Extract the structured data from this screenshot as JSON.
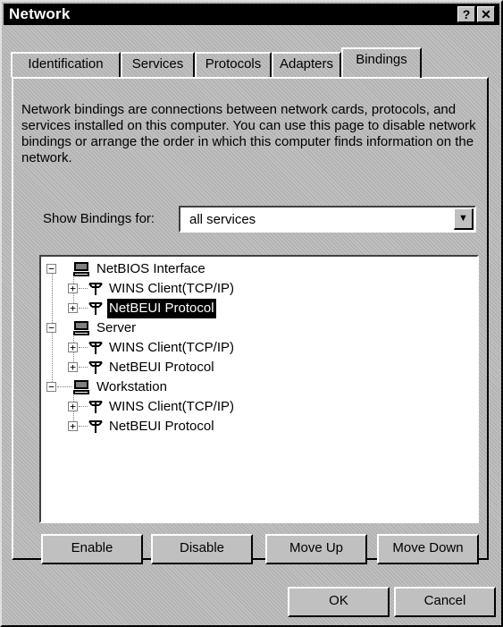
{
  "window": {
    "title": "Network"
  },
  "titlebar": {
    "help_label": "?",
    "close_label": "✕"
  },
  "tabs": [
    {
      "label": "Identification"
    },
    {
      "label": "Services"
    },
    {
      "label": "Protocols"
    },
    {
      "label": "Adapters"
    },
    {
      "label": "Bindings"
    }
  ],
  "active_tab": "Bindings",
  "description": "Network bindings are connections between network cards, protocols, and services installed on this computer. You can use this page to disable network bindings or arrange the order in which this computer finds information on the network.",
  "show_bindings": {
    "label": "Show Bindings for:",
    "value": "all services"
  },
  "tree": [
    {
      "label": "NetBIOS Interface",
      "icon": "computer-icon",
      "expanded": true,
      "children": [
        {
          "label": "WINS Client(TCP/IP)",
          "icon": "protocol-icon"
        },
        {
          "label": "NetBEUI Protocol",
          "icon": "protocol-icon",
          "selected": true
        }
      ]
    },
    {
      "label": "Server",
      "icon": "computer-icon",
      "expanded": true,
      "children": [
        {
          "label": "WINS Client(TCP/IP)",
          "icon": "protocol-icon"
        },
        {
          "label": "NetBEUI Protocol",
          "icon": "protocol-icon"
        }
      ]
    },
    {
      "label": "Workstation",
      "icon": "computer-icon",
      "expanded": true,
      "children": [
        {
          "label": "WINS Client(TCP/IP)",
          "icon": "protocol-icon"
        },
        {
          "label": "NetBEUI Protocol",
          "icon": "protocol-icon"
        }
      ]
    }
  ],
  "buttons": {
    "enable": {
      "label": "Enable"
    },
    "disable": {
      "label": "Disable"
    },
    "move_up": {
      "label": "Move Up"
    },
    "move_down": {
      "label": "Move Down"
    },
    "ok": {
      "label": "OK"
    },
    "cancel": {
      "label": "Cancel"
    }
  }
}
